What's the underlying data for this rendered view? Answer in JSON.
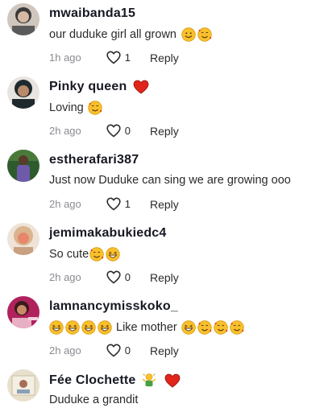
{
  "comments": [
    {
      "username": "mwaibanda15",
      "text": "our duduke girl all grown",
      "time": "1h ago",
      "likes": "1",
      "reply": "Reply",
      "avatar_colors": [
        "#3a3a3a",
        "#d7b9a3"
      ]
    },
    {
      "username": "Pinky queen",
      "text": "Loving",
      "time": "2h ago",
      "likes": "0",
      "reply": "Reply",
      "avatar_colors": [
        "#1f2a2e",
        "#b98a6a"
      ]
    },
    {
      "username": "estherafari387",
      "text": "Just now Duduke can sing we are growing ooo",
      "time": "2h ago",
      "likes": "1",
      "reply": "Reply",
      "avatar_colors": [
        "#2e5b2e",
        "#6e5aa8"
      ]
    },
    {
      "username": "jemimakabukiedc4",
      "text": "So cute",
      "time": "2h ago",
      "likes": "0",
      "reply": "Reply",
      "avatar_colors": [
        "#d9b48c",
        "#e8866c"
      ]
    },
    {
      "username": "lamnancymisskoko_",
      "text": "Like mother",
      "time": "2h ago",
      "likes": "0",
      "reply": "Reply",
      "avatar_colors": [
        "#b0225d",
        "#e8b0c4"
      ]
    },
    {
      "username": "Fée Clochette",
      "text": "Duduke a grandit",
      "avatar_colors": [
        "#e8e0cc",
        "#a86d5a"
      ]
    }
  ],
  "colors": {
    "muted": "#8a8b91",
    "red_heart": "#e1251b",
    "emoji_yellow": "#f9c02c"
  }
}
